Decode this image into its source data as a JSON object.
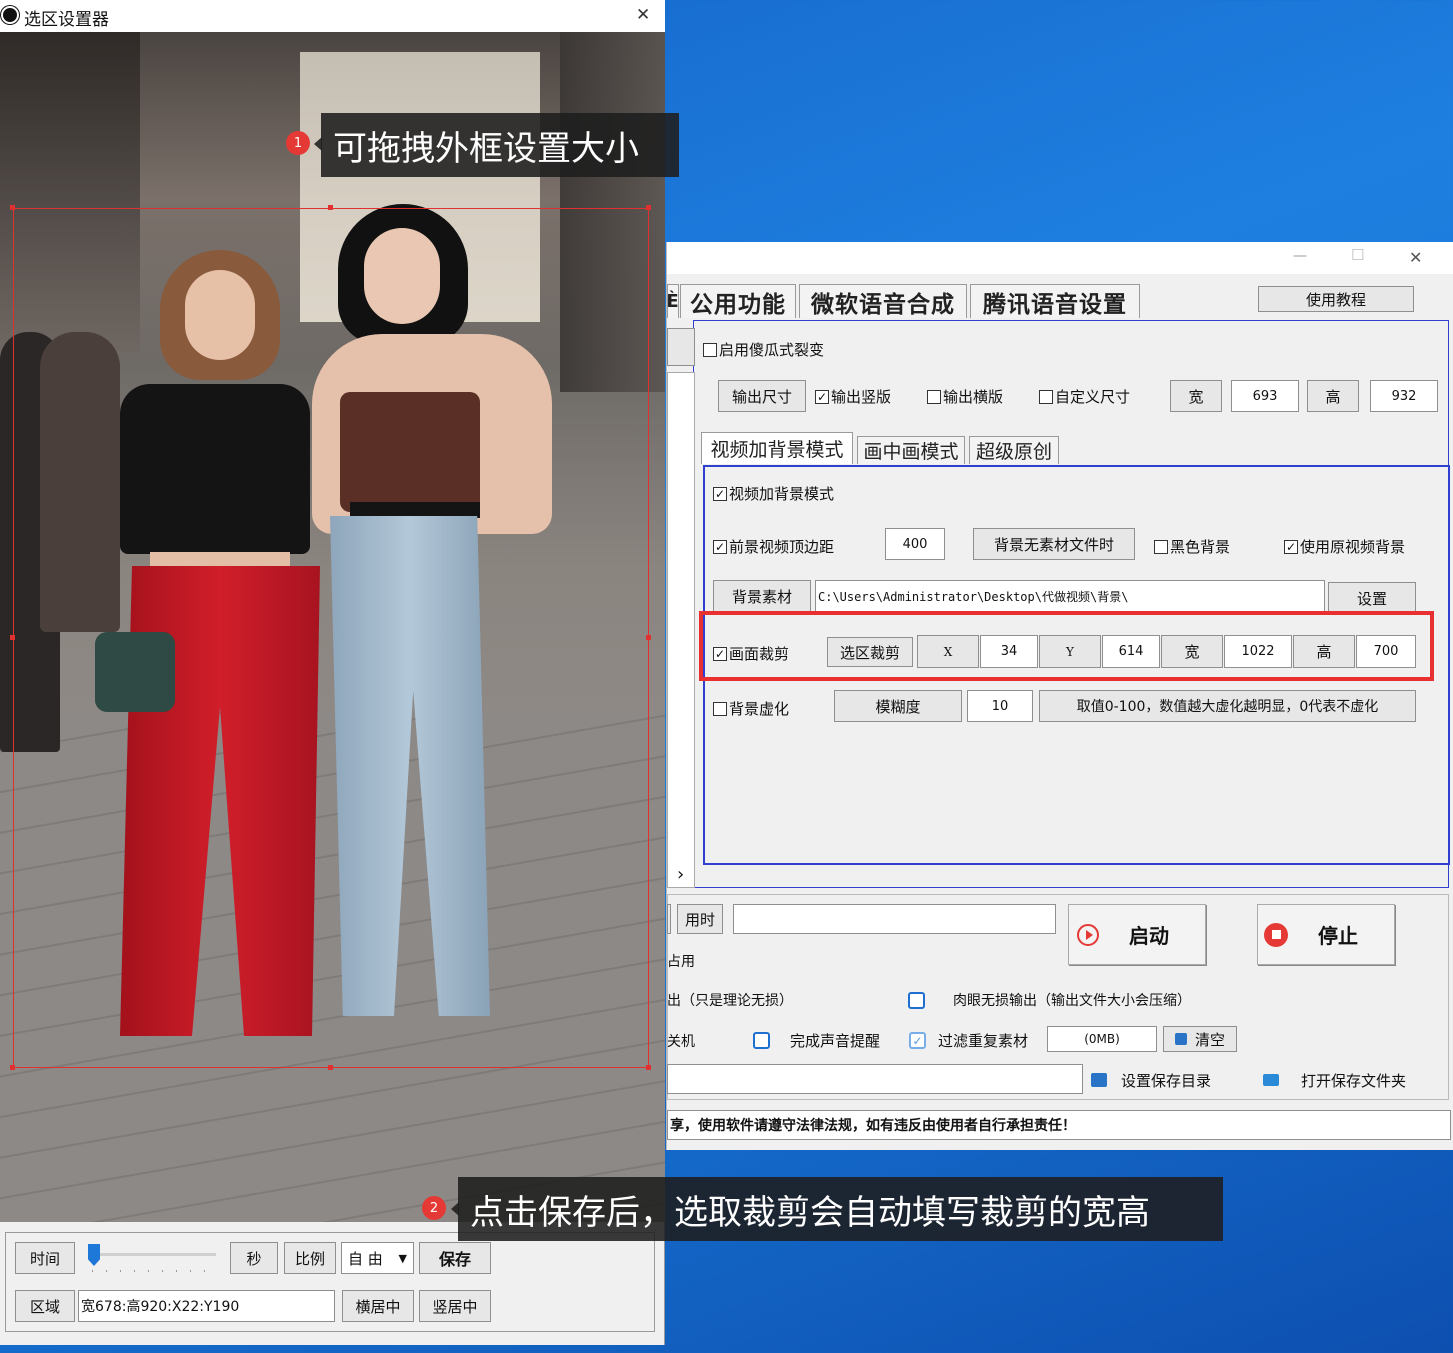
{
  "picker": {
    "title": "选区设置器",
    "close": "✕",
    "time_label": "时间",
    "sec_label": "秒",
    "ratio_label": "比例",
    "ratio_value": "自 由",
    "save_label": "保存",
    "area_label": "区域",
    "area_value": "宽678:高920:X22:Y190",
    "center_h_label": "横居中",
    "center_v_label": "竖居中"
  },
  "callouts": {
    "one_num": "1",
    "one_text": "可拖拽外框设置大小",
    "two_num": "2",
    "two_text": "点击保存后，选取裁剪会自动填写裁剪的宽高"
  },
  "main": {
    "window_controls": {
      "min": "—",
      "max": "☐",
      "close": "✕"
    },
    "tabs": [
      {
        "label": "公用功能"
      },
      {
        "label": "微软语音合成"
      },
      {
        "label": "腾讯语音设置"
      }
    ],
    "partial_tab": "È",
    "tutorial_label": "使用教程",
    "fool_split": {
      "label": "启用傻瓜式裂变",
      "checked": false
    },
    "output_size_label": "输出尺寸",
    "output_vertical": {
      "label": "输出竖版",
      "checked": true
    },
    "output_horizontal": {
      "label": "输出横版",
      "checked": false
    },
    "custom_size": {
      "label": "自定义尺寸",
      "checked": false
    },
    "width_label": "宽",
    "width_value": "693",
    "height_label": "高",
    "height_value": "932",
    "subtabs": [
      {
        "label": "视频加背景模式"
      },
      {
        "label": "画中画模式"
      },
      {
        "label": "超级原创"
      }
    ],
    "bg_mode": {
      "label": "视频加背景模式",
      "checked": true
    },
    "top_margin": {
      "label": "前景视频顶边距",
      "checked": true
    },
    "top_margin_value": "400",
    "no_bg_label": "背景无素材文件时",
    "black_bg": {
      "label": "黑色背景",
      "checked": false
    },
    "use_orig_bg": {
      "label": "使用原视频背景",
      "checked": true
    },
    "bg_material_label": "背景素材",
    "bg_path": "C:\\Users\\Administrator\\Desktop\\代做视频\\背景\\",
    "set_label": "设置",
    "crop": {
      "label": "画面裁剪",
      "checked": true
    },
    "select_crop_label": "选区裁剪",
    "x_label": "X",
    "x_value": "34",
    "y_label": "Y",
    "y_value": "614",
    "crop_w_label": "宽",
    "crop_w_value": "1022",
    "crop_h_label": "高",
    "crop_h_value": "700",
    "blur": {
      "label": "背景虚化",
      "checked": false
    },
    "blur_degree_label": "模糊度",
    "blur_value": "10",
    "blur_hint": "取值0-100，数值越大虚化越明显，0代表不虚化",
    "time_used_label": "用时",
    "start_label": "启动",
    "stop_label": "停止",
    "occupy_label": "占用",
    "lossless_label": "出（只是理论无损）",
    "eye_lossless": {
      "label": "肉眼无损输出（输出文件大小会压缩）",
      "checked": false
    },
    "shutdown_label": "关机",
    "sound_remind": {
      "label": "完成声音提醒",
      "checked": false
    },
    "filter_dup": {
      "label": "过滤重复素材",
      "checked": true
    },
    "size_value": "(0MB)",
    "clear_label": "清空",
    "set_save_dir_label": "设置保存目录",
    "open_save_dir_label": "打开保存文件夹",
    "notice": "享，使用软件请遵守法律法规，如有违反由使用者自行承担责任！",
    "scroll_arrow": "›"
  },
  "colors": {
    "highlight": "#e83030",
    "group_border": "#2f3fd0",
    "desktop": "#1877d6"
  }
}
